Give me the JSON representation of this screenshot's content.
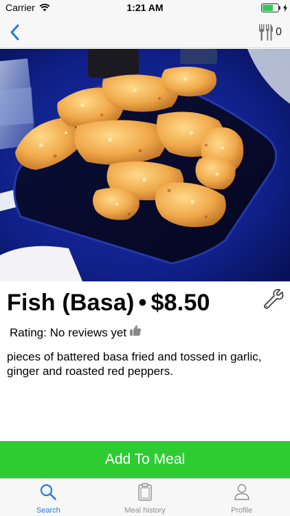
{
  "status_bar": {
    "carrier": "Carrier",
    "time": "1:21 AM",
    "battery_level": 0.7
  },
  "nav": {
    "back_icon": "chevron-left-icon",
    "cart_icon": "fork-knife-icon",
    "cart_count": "0"
  },
  "item": {
    "image_icon": "food-photo",
    "name": "Fish (Basa)",
    "separator": "•",
    "price": "$8.50",
    "rating_label": "Rating:",
    "rating_value": "No reviews yet",
    "description": "pieces of battered basa fried and tossed in garlic, ginger and roasted red peppers.",
    "edit_icon": "wrench-icon"
  },
  "actions": {
    "add_label": "Add To Meal"
  },
  "tabs": [
    {
      "label": "Search",
      "icon": "search-icon",
      "active": true
    },
    {
      "label": "Meal history",
      "icon": "clipboard-icon",
      "active": false
    },
    {
      "label": "Profile",
      "icon": "person-icon",
      "active": false
    }
  ],
  "colors": {
    "accent": "#1c7ae6",
    "add_button": "#2ecc33",
    "inactive_tab": "#8e8e93",
    "battery": "#34c759"
  }
}
